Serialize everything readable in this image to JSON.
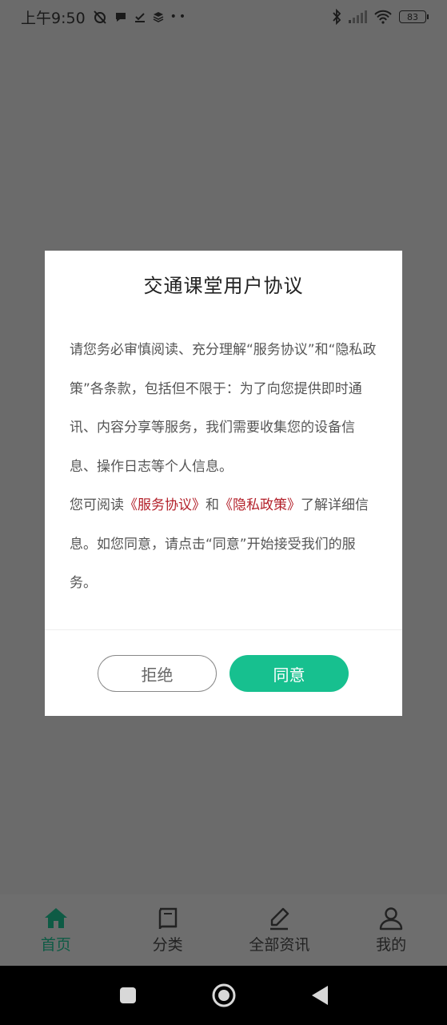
{
  "status_bar": {
    "time": "上午9:50",
    "battery": "83"
  },
  "dialog": {
    "title": "交通课堂用户协议",
    "p1": "请您务必审慎阅读、充分理解“服务协议”和“隐私政策”各条款，包括但不限于：为了向您提供即时通讯、内容分享等服务，我们需要收集您的设备信息、操作日志等个人信息。",
    "p2_prefix": "您可阅读",
    "link_service": "《服务协议》",
    "p2_and": "和",
    "link_privacy": "《隐私政策》",
    "p2_suffix": "了解详细信息。如您同意，请点击“同意”开始接受我们的服务。",
    "refuse_label": "拒绝",
    "agree_label": "同意"
  },
  "bottom_nav": {
    "items": [
      {
        "label": "首页",
        "icon": "home-icon"
      },
      {
        "label": "分类",
        "icon": "book-icon"
      },
      {
        "label": "全部资讯",
        "icon": "pencil-icon"
      },
      {
        "label": "我的",
        "icon": "user-icon"
      }
    ]
  },
  "colors": {
    "accent": "#17c08f",
    "link": "#b3202a",
    "active_nav": "#0e5b45"
  }
}
